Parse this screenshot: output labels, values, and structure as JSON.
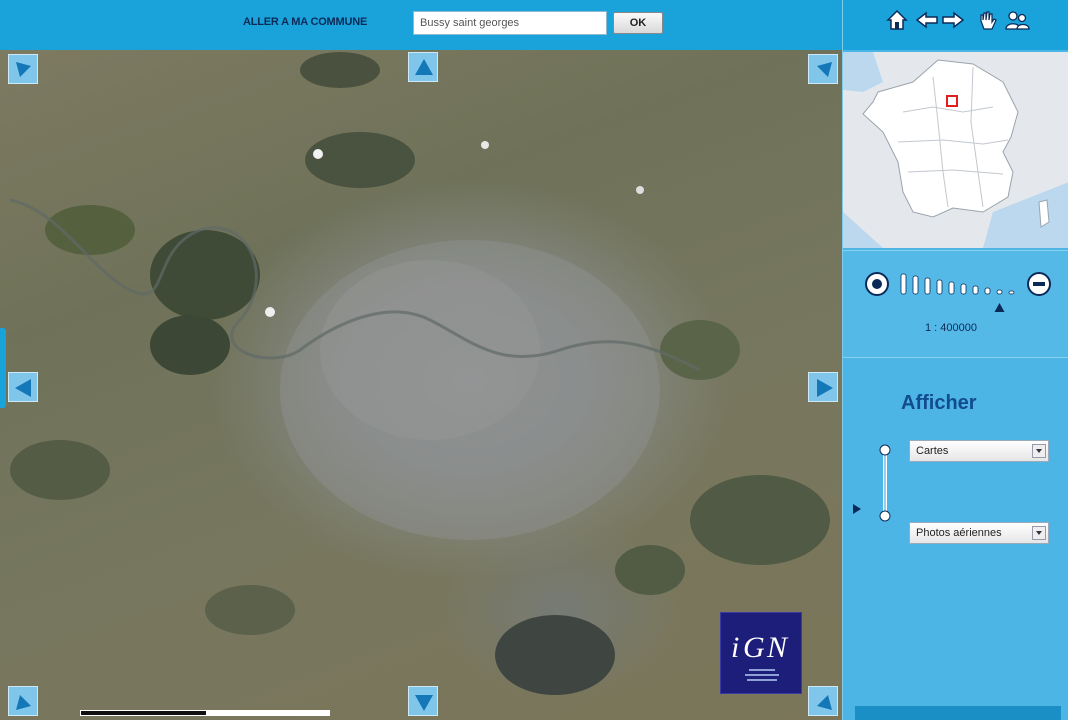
{
  "topbar": {
    "goto_label": "ALLER A MA COMMUNE",
    "commune_value": "Bussy saint georges",
    "ok_label": "OK"
  },
  "map": {
    "scale_bar": "",
    "logo_text": "IGN"
  },
  "toolbar": {
    "icons": [
      "home-icon",
      "arrow-left-icon",
      "arrow-right-icon",
      "hand-icon",
      "users-icon"
    ]
  },
  "zoom": {
    "scale_text": "1 : 400000",
    "levels": 10,
    "current_level": 9
  },
  "afficher": {
    "title": "Afficher",
    "layer_top": "Cartes",
    "layer_bottom": "Photos aériennes"
  },
  "colors": {
    "panel_bg": "#4db5e6",
    "bar_bg": "#1aa3db",
    "title": "#134b8f",
    "marker": "#e02020"
  }
}
